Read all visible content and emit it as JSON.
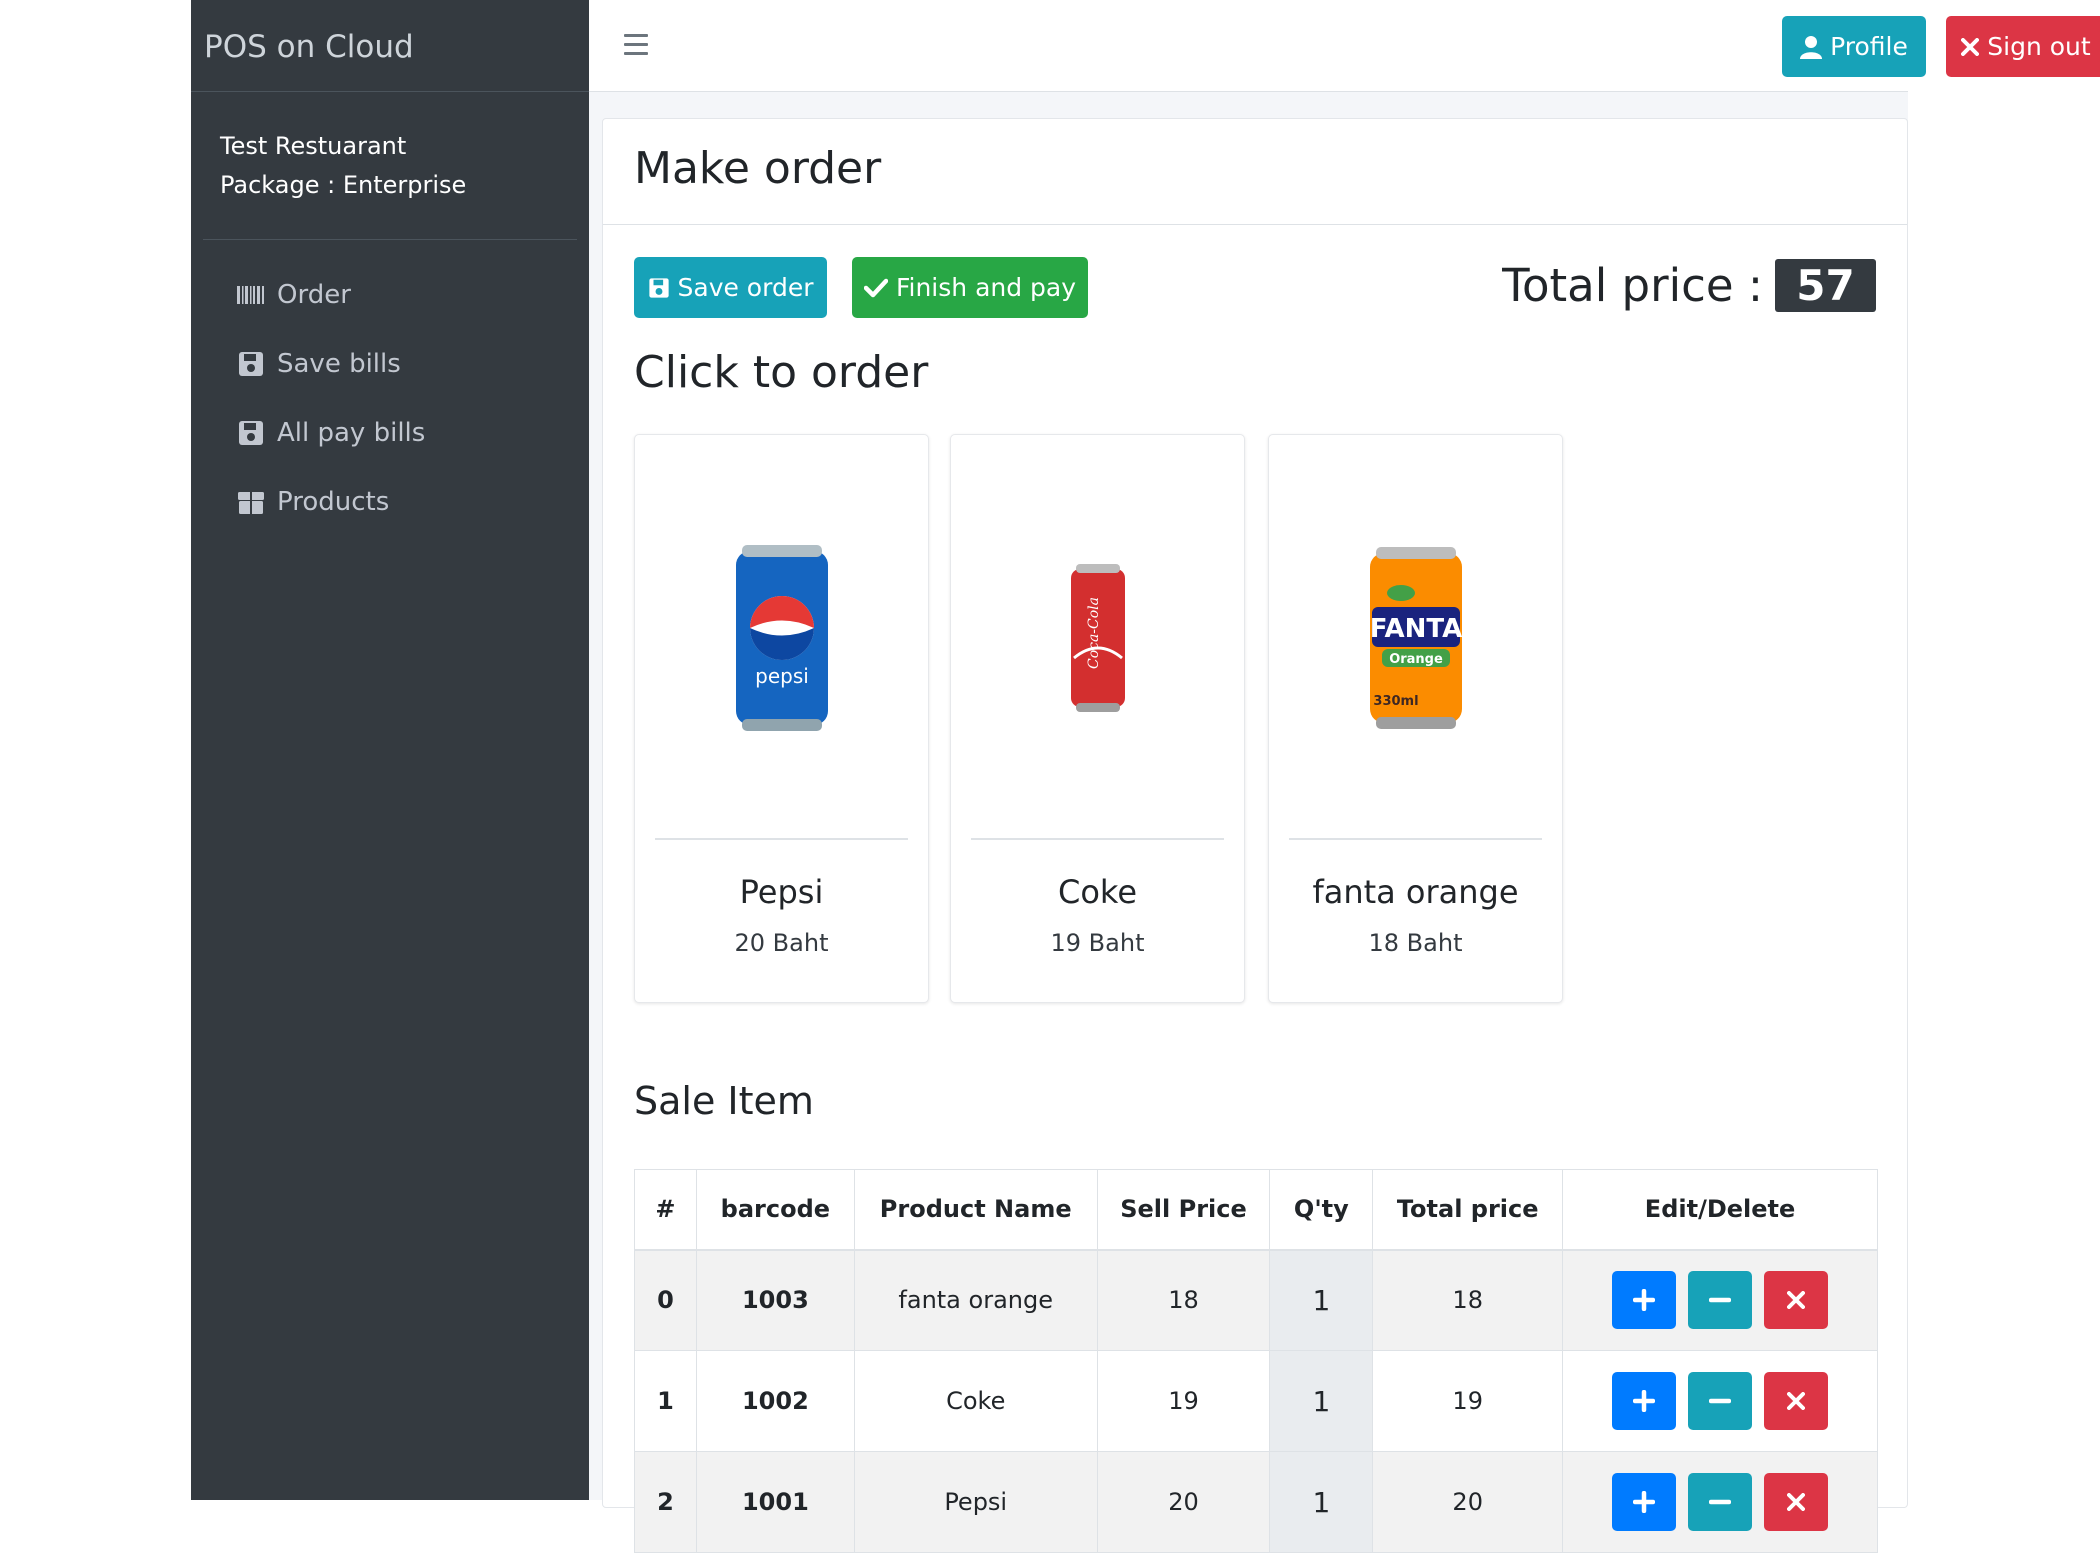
{
  "app": {
    "brand": "POS on Cloud",
    "restaurant": "Test Restuarant",
    "package": "Package : Enterprise"
  },
  "sidebar": {
    "items": [
      {
        "label": "Order",
        "icon": "barcode-icon"
      },
      {
        "label": "Save bills",
        "icon": "save-icon"
      },
      {
        "label": "All pay bills",
        "icon": "save-icon"
      },
      {
        "label": "Products",
        "icon": "box-icon"
      }
    ]
  },
  "topbar": {
    "profile_label": "Profile",
    "signout_label": "Sign out"
  },
  "page": {
    "title": "Make order",
    "save_label": "Save order",
    "finish_label": "Finish and pay",
    "total_label": "Total price :",
    "total_value": "57",
    "click_title": "Click to order",
    "sale_title": "Sale Item"
  },
  "products": [
    {
      "name": "Pepsi",
      "price": "20 Baht",
      "color": "#1565c0"
    },
    {
      "name": "Coke",
      "price": "19 Baht",
      "color": "#d32f2f"
    },
    {
      "name": "fanta orange",
      "price": "18 Baht",
      "color": "#fb8c00"
    }
  ],
  "table": {
    "headers": [
      "#",
      "barcode",
      "Product Name",
      "Sell Price",
      "Q'ty",
      "Total price",
      "Edit/Delete"
    ],
    "rows": [
      {
        "index": "0",
        "barcode": "1003",
        "name": "fanta orange",
        "price": "18",
        "qty": "1",
        "total": "18"
      },
      {
        "index": "1",
        "barcode": "1002",
        "name": "Coke",
        "price": "19",
        "qty": "1",
        "total": "19"
      },
      {
        "index": "2",
        "barcode": "1001",
        "name": "Pepsi",
        "price": "20",
        "qty": "1",
        "total": "20"
      }
    ]
  },
  "colors": {
    "sidebar_bg": "#343a40",
    "info": "#17a2b8",
    "danger": "#dc3545",
    "success": "#28a745",
    "primary": "#007bff"
  }
}
